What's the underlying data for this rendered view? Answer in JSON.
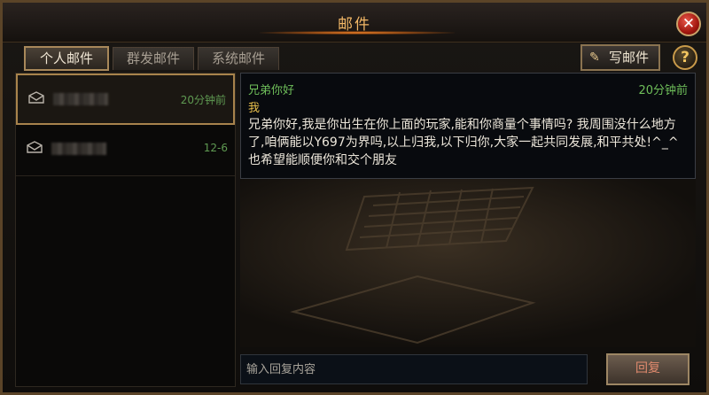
{
  "window": {
    "title": "邮件"
  },
  "header": {
    "close_icon": "close-icon",
    "close_symbol": "✕"
  },
  "tabs": [
    {
      "label": "个人邮件",
      "active": true
    },
    {
      "label": "群发邮件",
      "active": false
    },
    {
      "label": "系统邮件",
      "active": false
    }
  ],
  "toolbar": {
    "write_label": "写邮件",
    "write_icon": "pencil-icon",
    "help_label": "?"
  },
  "mail_list": [
    {
      "time": "20分钟前",
      "selected": true,
      "icon": "envelope-icon"
    },
    {
      "time": "12-6",
      "selected": false,
      "icon": "envelope-icon"
    }
  ],
  "message": {
    "subject": "兄弟你好",
    "time": "20分钟前",
    "sender": "我",
    "body": "兄弟你好,我是你出生在你上面的玩家,能和你商量个事情吗? 我周围没什么地方了,咱俩能以Y697为界吗,以上归我,以下归你,大家一起共同发展,和平共处!^_^也希望能顺便你和交个朋友"
  },
  "reply": {
    "placeholder": "输入回复内容",
    "button_label": "回复"
  },
  "colors": {
    "title": "#f3b867",
    "accent_border": "#a8834c",
    "time_green": "#6fbf5a",
    "sender_yellow": "#e9c04c",
    "close_red": "#c0291c"
  }
}
